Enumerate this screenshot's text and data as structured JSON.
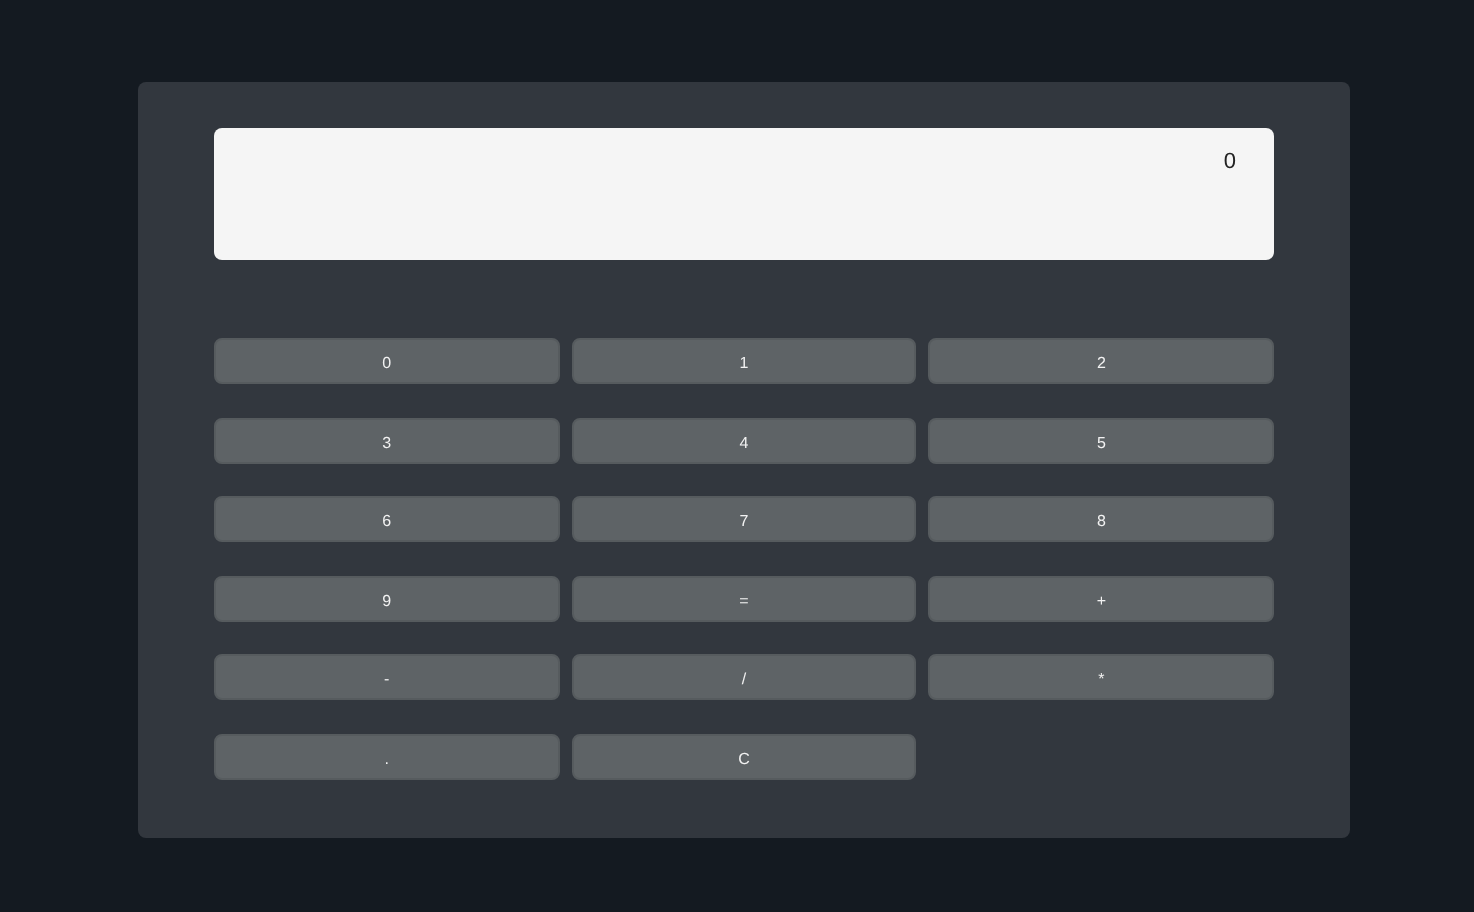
{
  "display": {
    "value": "0"
  },
  "key_rows": [
    [
      "0",
      "1",
      "2"
    ],
    [
      "3",
      "4",
      "5"
    ],
    [
      "6",
      "7",
      "8"
    ],
    [
      "9",
      "=",
      "+"
    ],
    [
      "-",
      "/",
      "*"
    ],
    [
      ".",
      "C"
    ]
  ]
}
